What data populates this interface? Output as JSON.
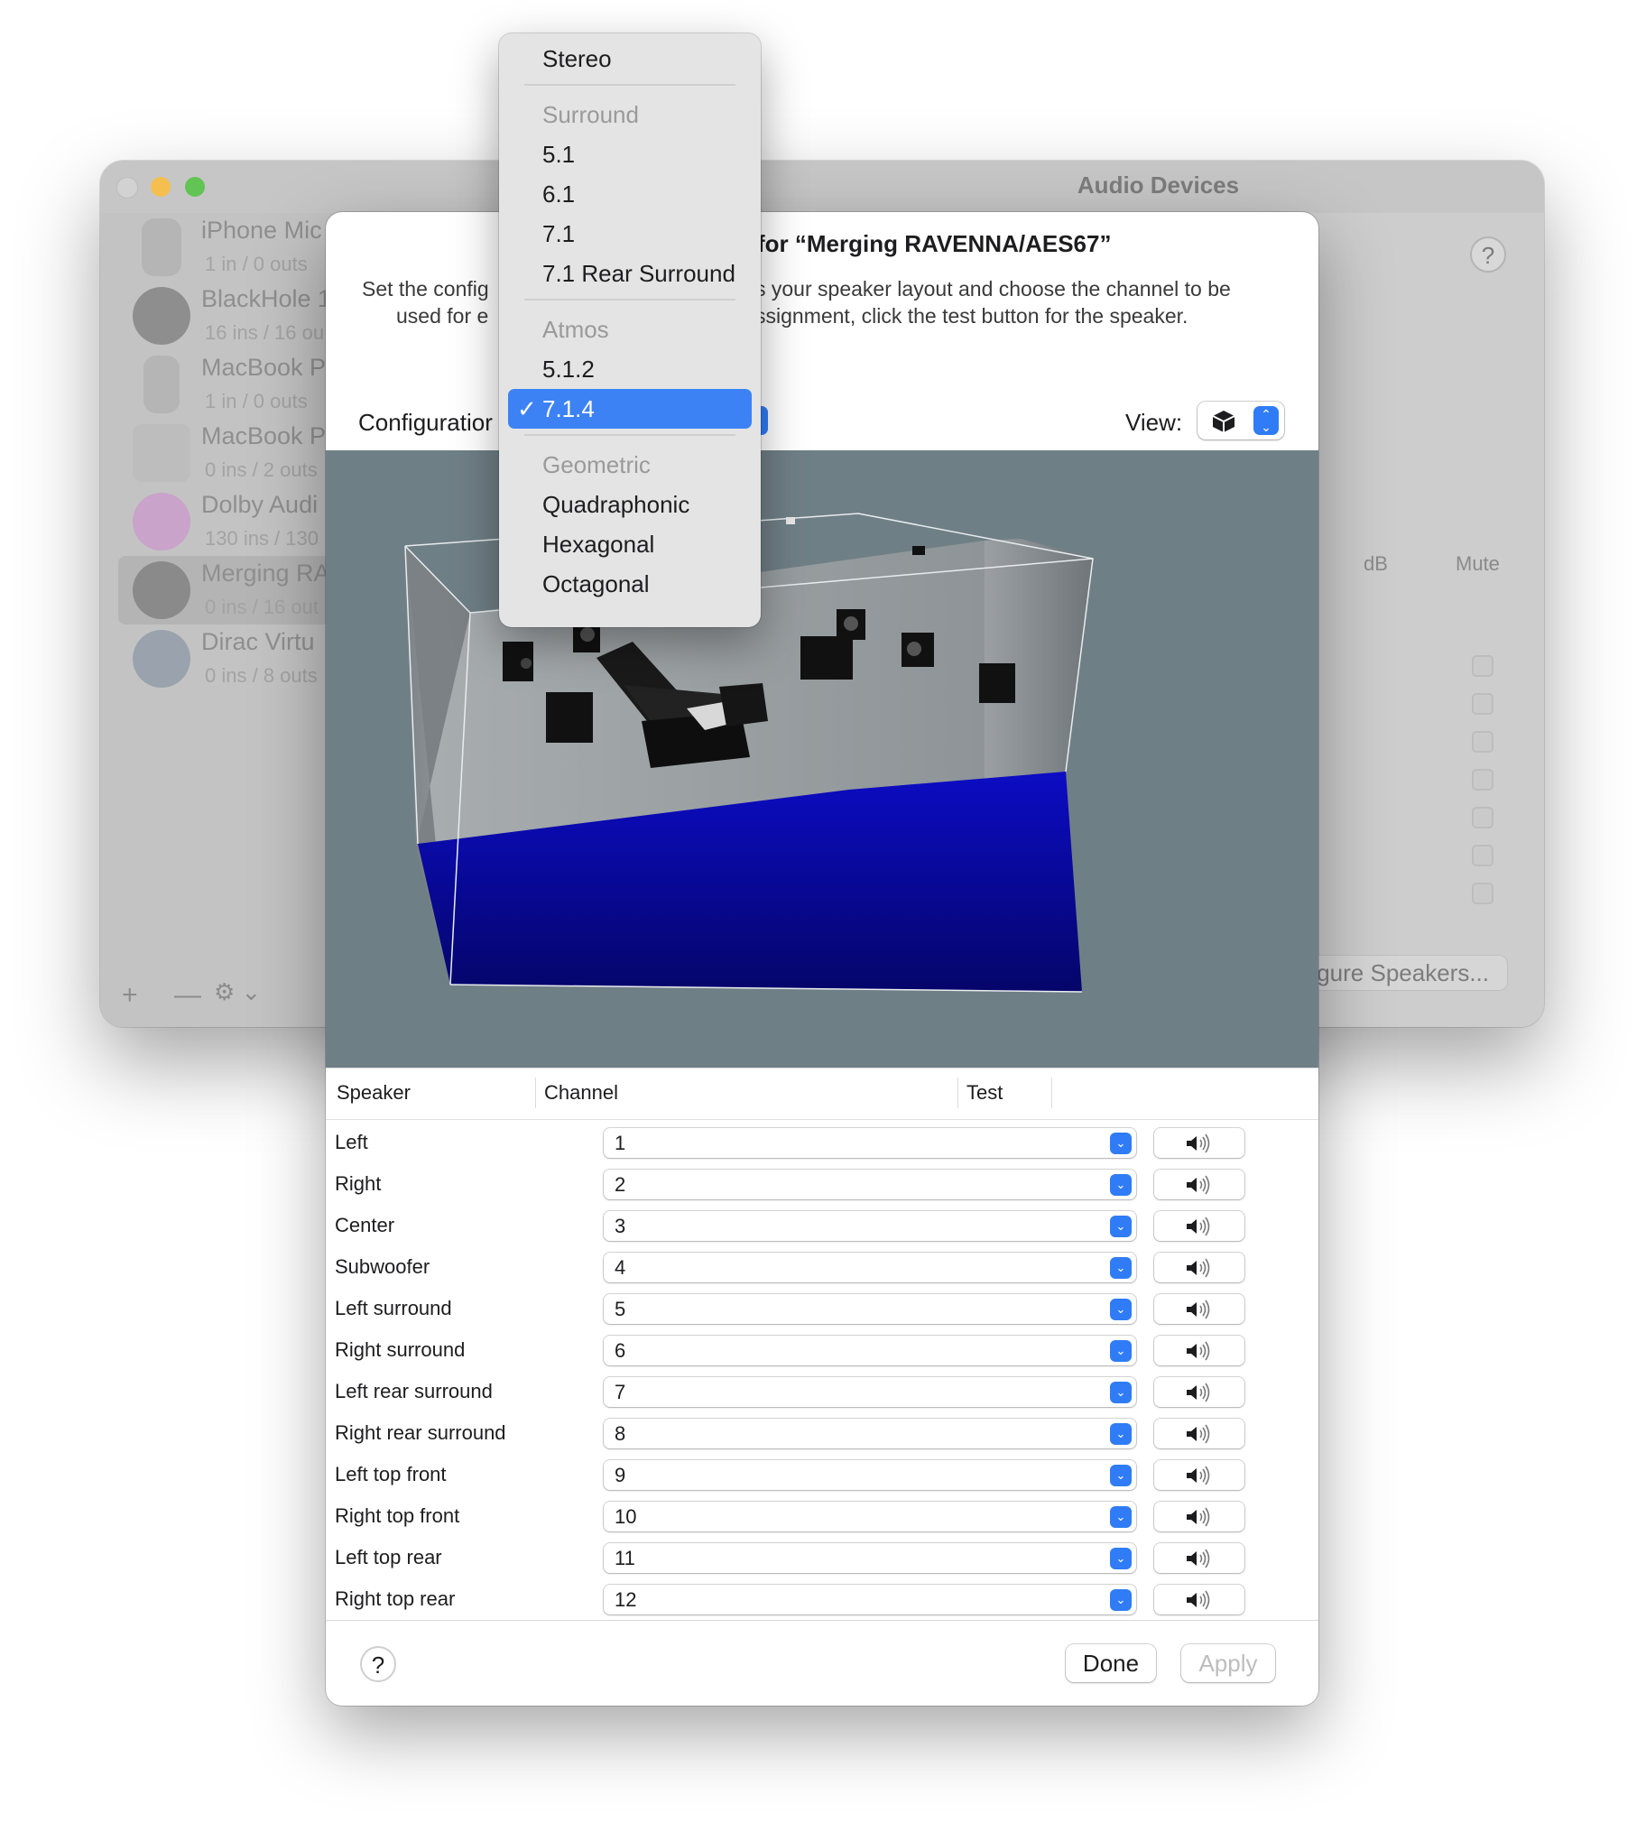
{
  "background_window": {
    "title": "Audio Devices",
    "help": "?",
    "devices": [
      {
        "name": "iPhone Mic",
        "io": "1 in / 0 outs"
      },
      {
        "name": "BlackHole 1",
        "io": "16 ins / 16 ou"
      },
      {
        "name": "MacBook P",
        "io": "1 in / 0 outs"
      },
      {
        "name": "MacBook P",
        "io": "0 ins / 2 outs"
      },
      {
        "name": "Dolby Audi",
        "io": "130 ins / 130"
      },
      {
        "name": "Merging RA",
        "io": "0 ins / 16 out"
      },
      {
        "name": "Dirac Virtu",
        "io": "0 ins / 8 outs"
      }
    ],
    "columns": {
      "db": "dB",
      "mute": "Mute"
    },
    "configure_button": "gure Speakers...",
    "footer": {
      "add": "+",
      "remove": "—",
      "gear": "⚙︎ ⌄"
    }
  },
  "sheet": {
    "title_visible": "for “Merging RAVENNA/AES67”",
    "desc_line1_left": "Set the config",
    "desc_line1_right": "s your speaker layout and choose the channel to be",
    "desc_line2_left": "used for e",
    "desc_line2_right": "ssignment, click the test button for the speaker.",
    "configuration_label": "Configuratior",
    "view_label": "View:",
    "columns": {
      "speaker": "Speaker",
      "channel": "Channel",
      "test": "Test"
    },
    "rows": [
      {
        "speaker": "Left",
        "channel": "1"
      },
      {
        "speaker": "Right",
        "channel": "2"
      },
      {
        "speaker": "Center",
        "channel": "3"
      },
      {
        "speaker": "Subwoofer",
        "channel": "4"
      },
      {
        "speaker": "Left surround",
        "channel": "5"
      },
      {
        "speaker": "Right surround",
        "channel": "6"
      },
      {
        "speaker": "Left rear surround",
        "channel": "7"
      },
      {
        "speaker": "Right rear surround",
        "channel": "8"
      },
      {
        "speaker": "Left top front",
        "channel": "9"
      },
      {
        "speaker": "Right top front",
        "channel": "10"
      },
      {
        "speaker": "Left top rear",
        "channel": "11"
      },
      {
        "speaker": "Right top rear",
        "channel": "12"
      }
    ],
    "buttons": {
      "help": "?",
      "done": "Done",
      "apply": "Apply"
    }
  },
  "menu": {
    "items": [
      {
        "label": "Stereo",
        "type": "item"
      },
      {
        "label": "Surround",
        "type": "header"
      },
      {
        "label": "5.1",
        "type": "item"
      },
      {
        "label": "6.1",
        "type": "item"
      },
      {
        "label": "7.1",
        "type": "item"
      },
      {
        "label": "7.1 Rear Surround",
        "type": "item"
      },
      {
        "label": "Atmos",
        "type": "header"
      },
      {
        "label": "5.1.2",
        "type": "item"
      },
      {
        "label": "7.1.4",
        "type": "selected"
      },
      {
        "label": "Geometric",
        "type": "header"
      },
      {
        "label": "Quadraphonic",
        "type": "item"
      },
      {
        "label": "Hexagonal",
        "type": "item"
      },
      {
        "label": "Octagonal",
        "type": "item"
      }
    ],
    "checkmark": "✓"
  },
  "colors": {
    "accent": "#3d82f5",
    "floor": "#0a0aa8",
    "scene_bg": "#6f7f86"
  }
}
